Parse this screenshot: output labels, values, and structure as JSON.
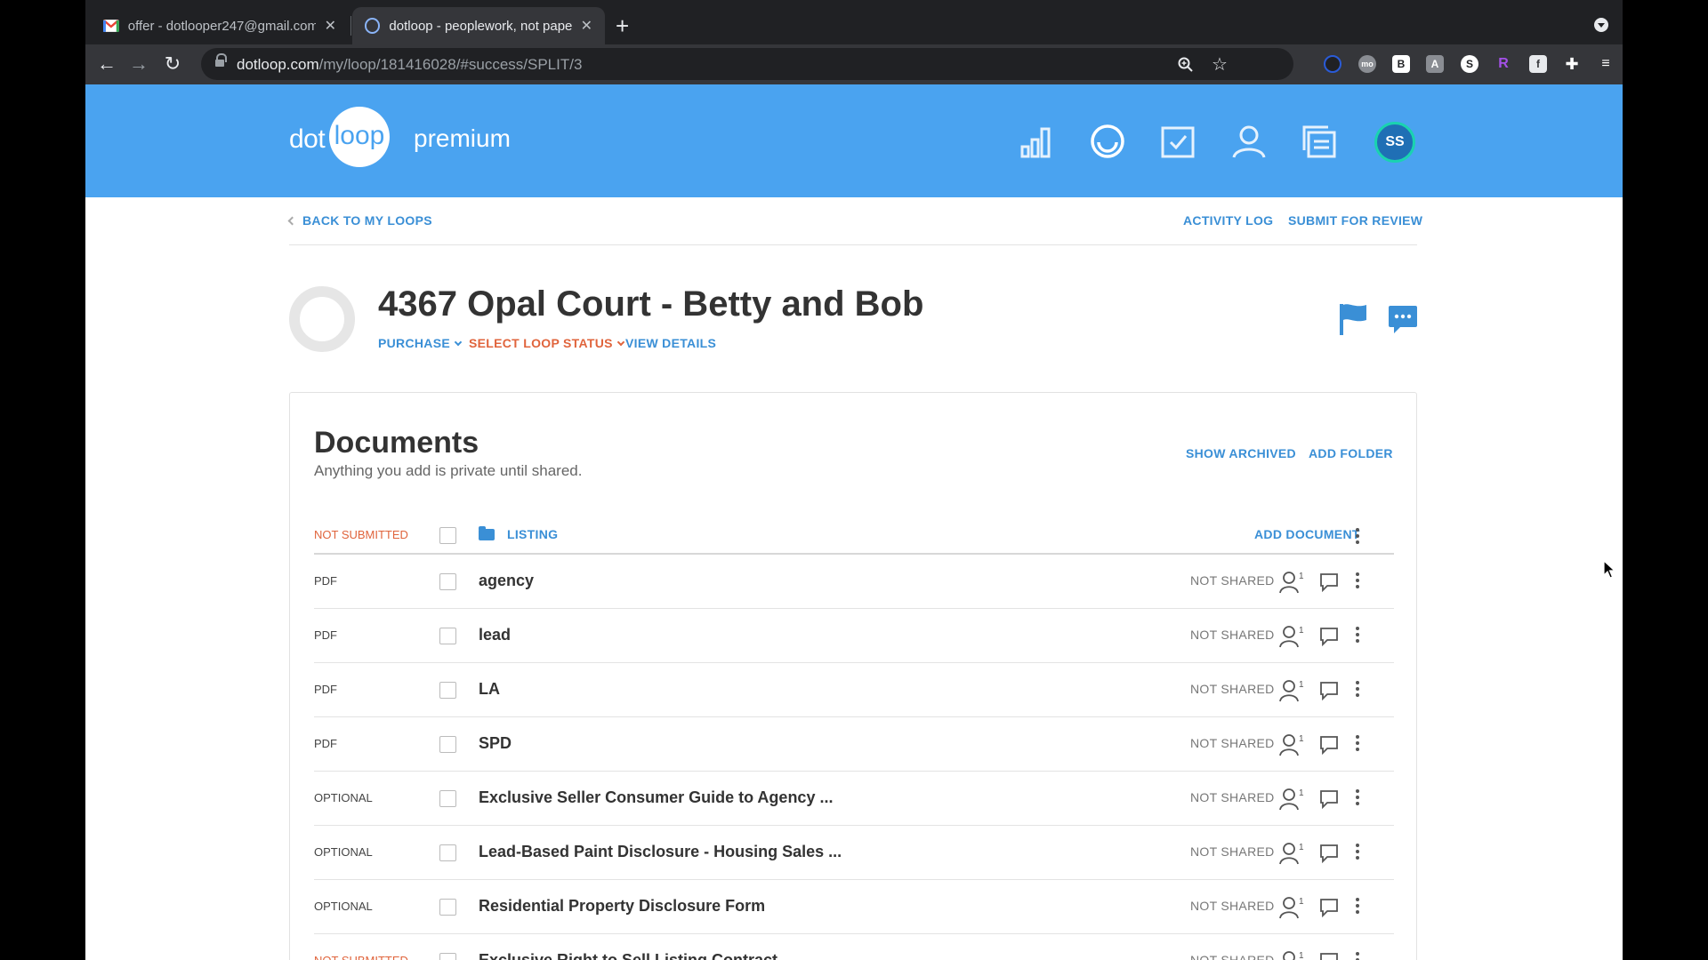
{
  "browser": {
    "tabs": [
      {
        "title": "offer - dotlooper247@gmail.com",
        "active": false
      },
      {
        "title": "dotloop - peoplework, not paperwork",
        "active": true
      }
    ],
    "url_host": "dotloop.com",
    "url_path": "/my/loop/181416028/#success/SPLIT/3",
    "extension_icons": [
      "zoom-icon",
      "star-icon",
      "ext-dark-icon",
      "ext-mo-icon",
      "ext-b-icon",
      "ext-a-icon",
      "ext-s-icon",
      "ext-r-icon",
      "ext-f-icon",
      "puzzle-icon",
      "queue-icon",
      "profile-icon",
      "menu-icon"
    ]
  },
  "header": {
    "logo_left": "dot",
    "logo_circle": "loop",
    "logo_right": "premium",
    "avatar_initials": "SS",
    "brand_color": "#4aa3f0",
    "avatar_ring_color": "#1ad3b0"
  },
  "nav": {
    "back_label": "BACK TO MY LOOPS",
    "activity_log": "ACTIVITY LOG",
    "submit_for_review": "SUBMIT FOR REVIEW"
  },
  "loop": {
    "title": "4367 Opal Court - Betty and Bob",
    "type": "PURCHASE",
    "status": "SELECT LOOP STATUS",
    "view_details": "VIEW DETAILS"
  },
  "documents": {
    "title": "Documents",
    "subtitle": "Anything you add is private until shared.",
    "show_archived": "SHOW ARCHIVED",
    "add_folder": "ADD FOLDER",
    "folder": {
      "status": "NOT SUBMITTED",
      "name": "LISTING",
      "add_document": "ADD DOCUMENT"
    },
    "rows": [
      {
        "type": "PDF",
        "name": "agency",
        "shared": "NOT SHARED",
        "participants": "1"
      },
      {
        "type": "PDF",
        "name": "lead",
        "shared": "NOT SHARED",
        "participants": "1"
      },
      {
        "type": "PDF",
        "name": "LA",
        "shared": "NOT SHARED",
        "participants": "1"
      },
      {
        "type": "PDF",
        "name": "SPD",
        "shared": "NOT SHARED",
        "participants": "1"
      },
      {
        "type": "OPTIONAL",
        "name": "Exclusive Seller Consumer Guide to Agency ...",
        "shared": "NOT SHARED",
        "participants": "1"
      },
      {
        "type": "OPTIONAL",
        "name": "Lead-Based Paint Disclosure - Housing Sales ...",
        "shared": "NOT SHARED",
        "participants": "1"
      },
      {
        "type": "OPTIONAL",
        "name": "Residential Property Disclosure Form",
        "shared": "NOT SHARED",
        "participants": "1"
      },
      {
        "type": "NOT SUBMITTED",
        "name": "Exclusive Right to Sell Listing Contract",
        "shared": "NOT SHARED",
        "participants": "1"
      }
    ]
  }
}
